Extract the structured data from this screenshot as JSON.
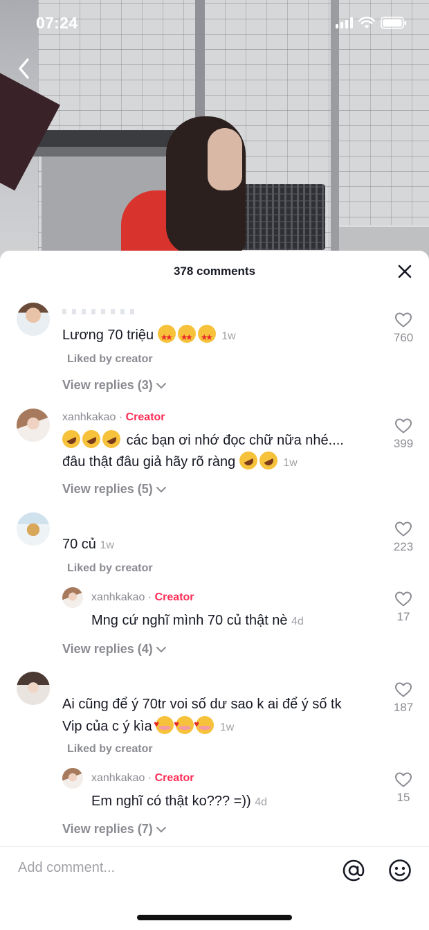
{
  "status_bar": {
    "time": "07:24"
  },
  "sheet": {
    "title": "378 comments"
  },
  "comments": [
    {
      "text": "Lương 70 triệu",
      "time": "1w",
      "liked_by": "Liked by creator",
      "likes": "760",
      "view_replies": "View replies (3)"
    },
    {
      "username": "xanhkakao",
      "badge": "Creator",
      "line1": "các bạn ơi nhớ đọc chữ nữa nhé....",
      "line2": "đâu thật đâu giả hãy rõ ràng",
      "time": "1w",
      "likes": "399",
      "view_replies": "View replies (5)"
    },
    {
      "text": "70 củ",
      "time": "1w",
      "liked_by": "Liked by creator",
      "likes": "223",
      "reply": {
        "username": "xanhkakao",
        "badge": "Creator",
        "text": "Mng cứ nghĩ mình 70 củ thật nè",
        "time": "4d",
        "likes": "17"
      },
      "view_replies": "View replies (4)"
    },
    {
      "line1": "Ai cũng để ý 70tr voi số dư sao k ai để ý số tk",
      "line2": "Vip của c ý kìa",
      "time": "1w",
      "liked_by": "Liked by creator",
      "likes": "187",
      "reply": {
        "username": "xanhkakao",
        "badge": "Creator",
        "text": "Em nghĩ có thật ko??? =))",
        "time": "4d",
        "likes": "15"
      },
      "view_replies": "View replies (7)"
    }
  ],
  "composer": {
    "placeholder": "Add comment..."
  },
  "separator": "·",
  "colors": {
    "creator": "#fe2c55",
    "muted": "#8a8b91",
    "text": "#161823"
  }
}
